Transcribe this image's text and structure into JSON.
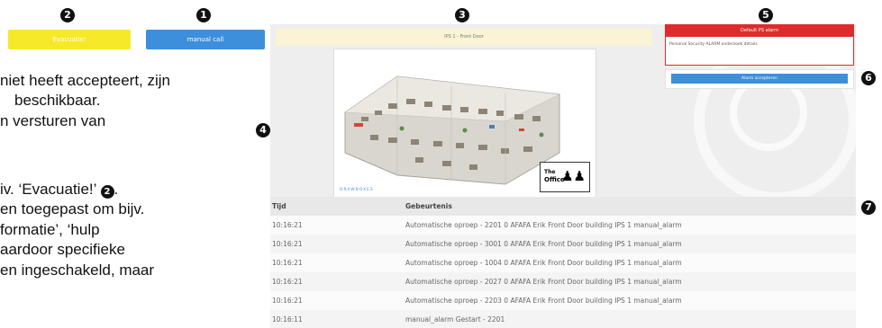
{
  "markers": {
    "m1": "1",
    "m2": "2",
    "m3": "3",
    "m4": "4",
    "m5": "5",
    "m6": "6",
    "m7": "7"
  },
  "buttons": {
    "evacuatie": "Evacuatie!",
    "manual_call": "manual call"
  },
  "text_lines": [
    "niet heeft accepteert, zijn",
    "beschikbaar.",
    "n versturen van",
    "iv. ‘Evacuatie!’",
    "en toegepast om bijv.",
    "formatie’, ‘hulp",
    "aardoor specifieke",
    "en ingeschakeld, maar"
  ],
  "screen": {
    "zone_label": "IPS 1 - Front Door",
    "alarm_title": "Default PS alarm",
    "alarm_detail": "Personal Security ALARM onderzoek details",
    "accept_label": "Alarm accepteren",
    "brand_label": "DRAWBOXES",
    "office_label_1": "The",
    "office_label_2": "Office"
  },
  "table": {
    "headers": [
      "Tijd",
      "Gebeurtenis"
    ],
    "rows": [
      [
        "10:16:21",
        "Automatische oproep - 2201 0 AFAFA Erik Front Door building IPS 1 manual_alarm"
      ],
      [
        "10:16:21",
        "Automatische oproep - 3001 0 AFAFA Erik Front Door building IPS 1 manual_alarm"
      ],
      [
        "10:16:21",
        "Automatische oproep - 1004 0 AFAFA Erik Front Door building IPS 1 manual_alarm"
      ],
      [
        "10:16:21",
        "Automatische oproep - 2027 0 AFAFA Erik Front Door building IPS 1 manual_alarm"
      ],
      [
        "10:16:21",
        "Automatische oproep - 2203 0 AFAFA Erik Front Door building IPS 1 manual_alarm"
      ],
      [
        "10:16:11",
        "manual_alarm Gestart - 2201"
      ]
    ]
  },
  "colors": {
    "evacuatie": "#f5e92a",
    "manual_call": "#3d8fdc",
    "alarm_red": "#dd2c2c",
    "zone_bg": "#faf4d4"
  }
}
